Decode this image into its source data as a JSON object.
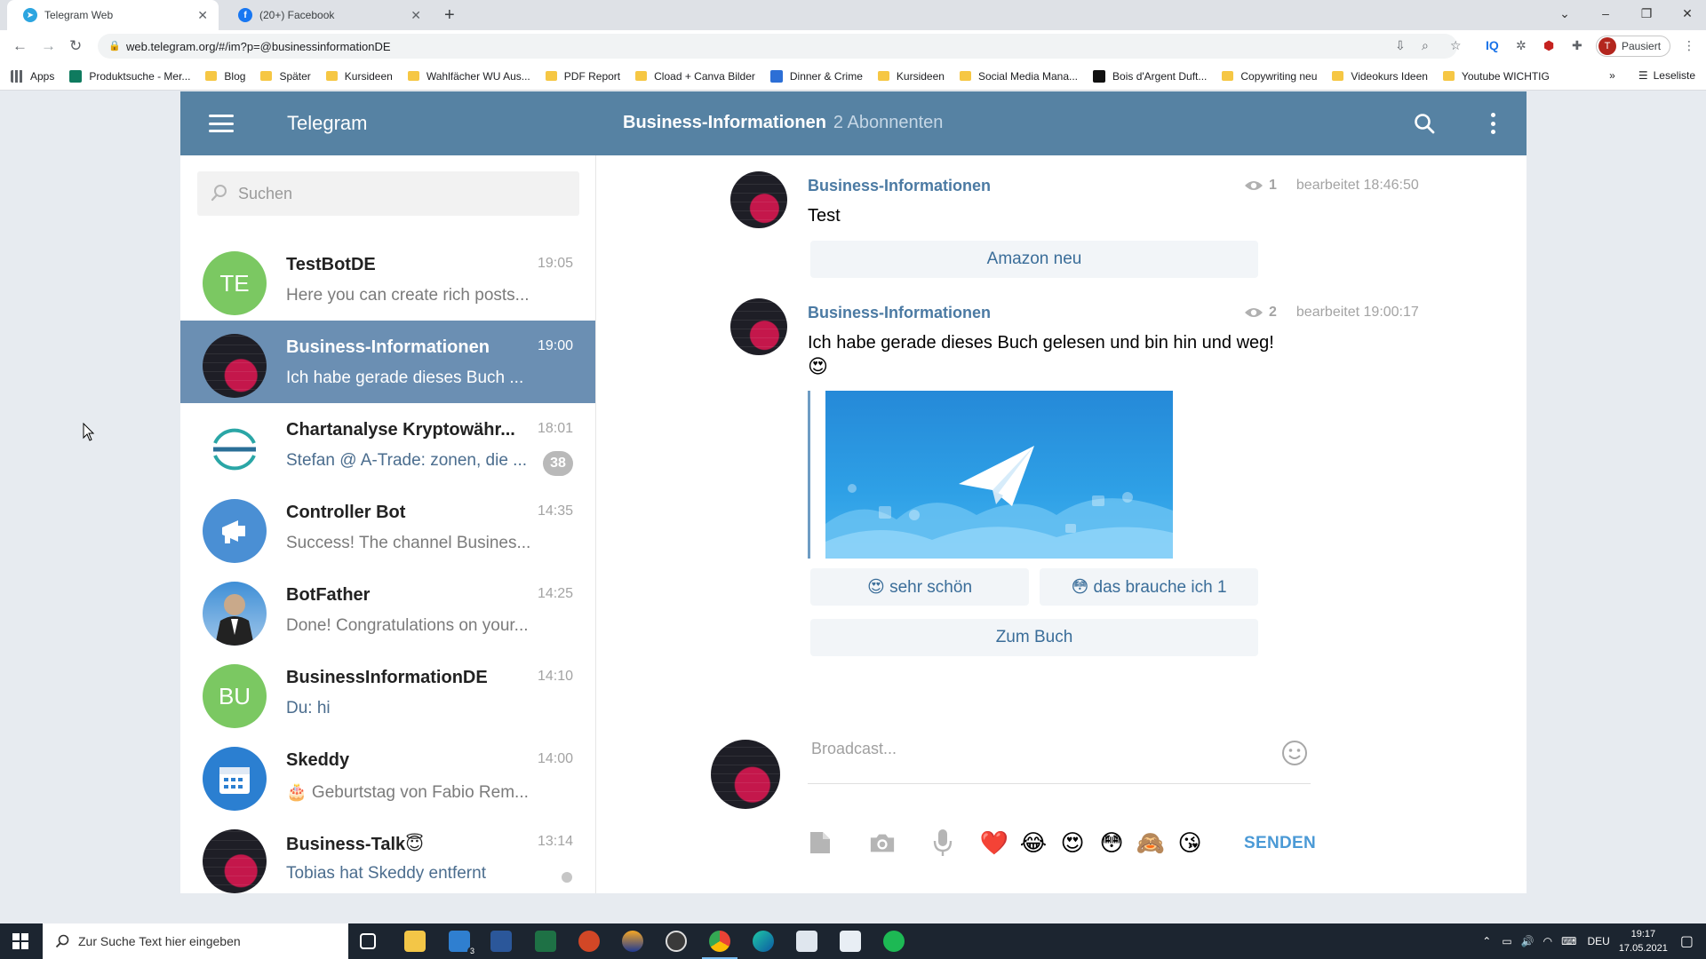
{
  "browser": {
    "tabs": [
      {
        "title": "Telegram Web",
        "active": true
      },
      {
        "title": "(20+) Facebook",
        "active": false
      }
    ],
    "url": "web.telegram.org/#/im?p=@businessinformationDE",
    "profile_label": "Pausiert",
    "profile_initial": "T",
    "bookmarks": [
      "Apps",
      "Produktsuche - Mer...",
      "Blog",
      "Später",
      "Kursideen",
      "Wahlfächer WU Aus...",
      "PDF Report",
      "Cload + Canva Bilder",
      "Dinner & Crime",
      "Kursideen",
      "Social Media Mana...",
      "Bois d'Argent Duft...",
      "Copywriting neu",
      "Videokurs Ideen",
      "Youtube WICHTIG"
    ],
    "reading_list": "Leseliste",
    "more": "»"
  },
  "telegram": {
    "app_title": "Telegram",
    "peer_name": "Business-Informationen",
    "peer_subscribers": "2 Abonnenten",
    "search_placeholder": "Suchen",
    "dialogs": [
      {
        "avatar_text": "TE",
        "avatar_color": "#7bc862",
        "name": "TestBotDE",
        "time": "19:05",
        "message": "Here you can create rich posts...",
        "active": false
      },
      {
        "avatar_text": "",
        "avatar_color": "#1e1e26",
        "name": "Business-Informationen",
        "time": "19:00",
        "message": "Ich habe gerade dieses Buch ...",
        "active": true
      },
      {
        "avatar_text": "",
        "avatar_color": "#ffffff",
        "name": "Chartanalyse Kryptowähr...",
        "time": "18:01",
        "message": "Stefan @ A-Trade: zonen, die ...",
        "badge": "38",
        "active": false
      },
      {
        "avatar_text": "",
        "avatar_color": "#4a8fd4",
        "name": "Controller Bot",
        "time": "14:35",
        "message": "Success! The channel Busines...",
        "active": false
      },
      {
        "avatar_text": "",
        "avatar_color": "#3f8fd6",
        "name": "BotFather",
        "time": "14:25",
        "message": "Done! Congratulations on your...",
        "active": false
      },
      {
        "avatar_text": "BU",
        "avatar_color": "#7bc862",
        "name": "BusinessInformationDE",
        "time": "14:10",
        "message": "Du: hi",
        "active": false
      },
      {
        "avatar_text": "",
        "avatar_color": "#2b7fd1",
        "name": "Skeddy",
        "time": "14:00",
        "message": "🎂 Geburtstag von Fabio Rem...",
        "active": false
      },
      {
        "avatar_text": "",
        "avatar_color": "#1e1e26",
        "name": "Business-Talk😇",
        "time": "13:14",
        "message": "Tobias hat Skeddy entfernt",
        "dot": true,
        "active": false
      }
    ],
    "posts": [
      {
        "author": "Business-Informationen",
        "views": "1",
        "edited": "bearbeitet 18:46:50",
        "text": "Test",
        "buttons": [
          "Amazon neu"
        ]
      },
      {
        "author": "Business-Informationen",
        "views": "2",
        "edited": "bearbeitet 19:00:17",
        "text": "Ich habe gerade dieses Buch gelesen und bin hin und weg!",
        "emoji": "😍",
        "reactions": [
          "😍 sehr schön",
          "😳 das brauche ich 1"
        ],
        "buttons": [
          "Zum Buch"
        ]
      }
    ],
    "composer_placeholder": "Broadcast...",
    "quick_emojis": [
      "❤️",
      "😂",
      "😍",
      "😳",
      "🙈",
      "😘"
    ],
    "send_label": "SENDEN"
  },
  "taskbar": {
    "search_placeholder": "Zur Suche Text hier eingeben",
    "language": "DEU",
    "time": "19:17",
    "date": "17.05.2021",
    "mail_badge": "3"
  }
}
